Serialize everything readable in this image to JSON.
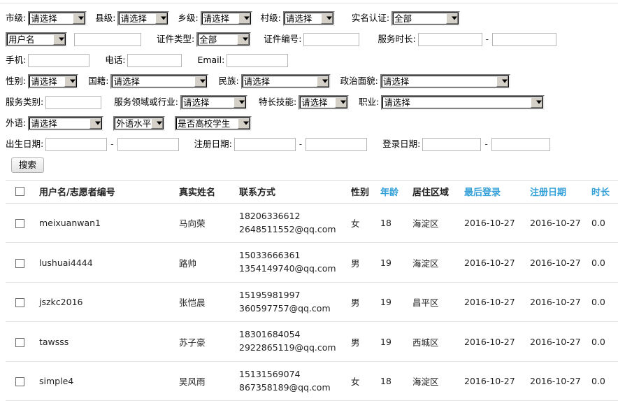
{
  "filters": {
    "row1": {
      "city_label": "市级:",
      "city_value": "请选择",
      "county_label": "县级:",
      "county_value": "请选择",
      "township_label": "乡级:",
      "township_value": "请选择",
      "village_label": "村级:",
      "village_value": "请选择",
      "realname_auth_label": "实名认证:",
      "realname_auth_value": "全部"
    },
    "row2": {
      "keyword_type_value": "用户名",
      "keyword_value": "",
      "id_type_label": "证件类型:",
      "id_type_value": "全部",
      "id_number_label": "证件编号:",
      "id_number_value": "",
      "service_hours_label": "服务时长:",
      "service_hours_from": "",
      "service_hours_to": "",
      "range_separator": "-"
    },
    "row3": {
      "mobile_label": "手机:",
      "mobile_value": "",
      "phone_label": "电话:",
      "phone_value": "",
      "email_label": "Email:",
      "email_value": ""
    },
    "row4": {
      "gender_label": "性别:",
      "gender_value": "请选择",
      "nationality_label": "国籍:",
      "nationality_value": "请选择",
      "ethnicity_label": "民族:",
      "ethnicity_value": "请选择",
      "political_label": "政治面貌:",
      "political_value": "请选择"
    },
    "row5": {
      "service_category_label": "服务类别:",
      "service_category_value": "",
      "service_field_label": "服务领域或行业:",
      "service_field_value": "请选择",
      "skill_label": "特长技能:",
      "skill_value": "请选择",
      "occupation_label": "职业:",
      "occupation_value": "请选择"
    },
    "row6": {
      "language_label": "外语:",
      "language_value": "请选择",
      "language_level_value": "外语水平",
      "is_college_student_value": "是否高校学生"
    },
    "row7": {
      "birth_date_label": "出生日期:",
      "birth_date_from": "",
      "birth_date_to": "",
      "register_date_label": "注册日期:",
      "register_date_from": "",
      "register_date_to": "",
      "login_date_label": "登录日期:",
      "login_date_from": "",
      "login_date_to": "",
      "range_separator": "-"
    },
    "search_button": "搜索"
  },
  "table": {
    "columns": [
      {
        "key": "checkbox",
        "label": "",
        "sortable": false
      },
      {
        "key": "username",
        "label": "用户名/志愿者编号",
        "sortable": false
      },
      {
        "key": "realname",
        "label": "真实姓名",
        "sortable": false
      },
      {
        "key": "contact",
        "label": "联系方式",
        "sortable": false
      },
      {
        "key": "gender",
        "label": "性别",
        "sortable": false
      },
      {
        "key": "age",
        "label": "年龄",
        "sortable": true
      },
      {
        "key": "area",
        "label": "居住区域",
        "sortable": false
      },
      {
        "key": "last_login",
        "label": "最后登录",
        "sortable": true
      },
      {
        "key": "register_date",
        "label": "注册日期",
        "sortable": true
      },
      {
        "key": "duration",
        "label": "时长",
        "sortable": true
      }
    ],
    "rows": [
      {
        "username": "meixuanwan1",
        "realname": "马向荣",
        "phone": "18206336612",
        "email": "2648511552@qq.com",
        "gender": "女",
        "age": "18",
        "area": "海淀区",
        "last_login": "2016-10-27",
        "register_date": "2016-10-27",
        "duration": "0.0"
      },
      {
        "username": "lushuai4444",
        "realname": "路帅",
        "phone": "15033666361",
        "email": "1354149740@qq.com",
        "gender": "男",
        "age": "19",
        "area": "海淀区",
        "last_login": "2016-10-27",
        "register_date": "2016-10-27",
        "duration": "0.0"
      },
      {
        "username": "jszkc2016",
        "realname": "张恺晨",
        "phone": "15195981997",
        "email": "360597757@qq.com",
        "gender": "男",
        "age": "19",
        "area": "昌平区",
        "last_login": "2016-10-27",
        "register_date": "2016-10-27",
        "duration": "0.0"
      },
      {
        "username": "tawsss",
        "realname": "苏子豪",
        "phone": "18301684054",
        "email": "2922865119@qq.com",
        "gender": "男",
        "age": "19",
        "area": "西城区",
        "last_login": "2016-10-27",
        "register_date": "2016-10-27",
        "duration": "0.0"
      },
      {
        "username": "simple4",
        "realname": "吴风雨",
        "phone": "15131569074",
        "email": "867358189@qq.com",
        "gender": "女",
        "age": "18",
        "area": "海淀区",
        "last_login": "2016-10-27",
        "register_date": "2016-10-27",
        "duration": "0.0"
      }
    ]
  },
  "colors": {
    "sortable_header": "#33a0d8",
    "muted_text": "#b0b0b0",
    "row_border": "#e4e4e4"
  }
}
